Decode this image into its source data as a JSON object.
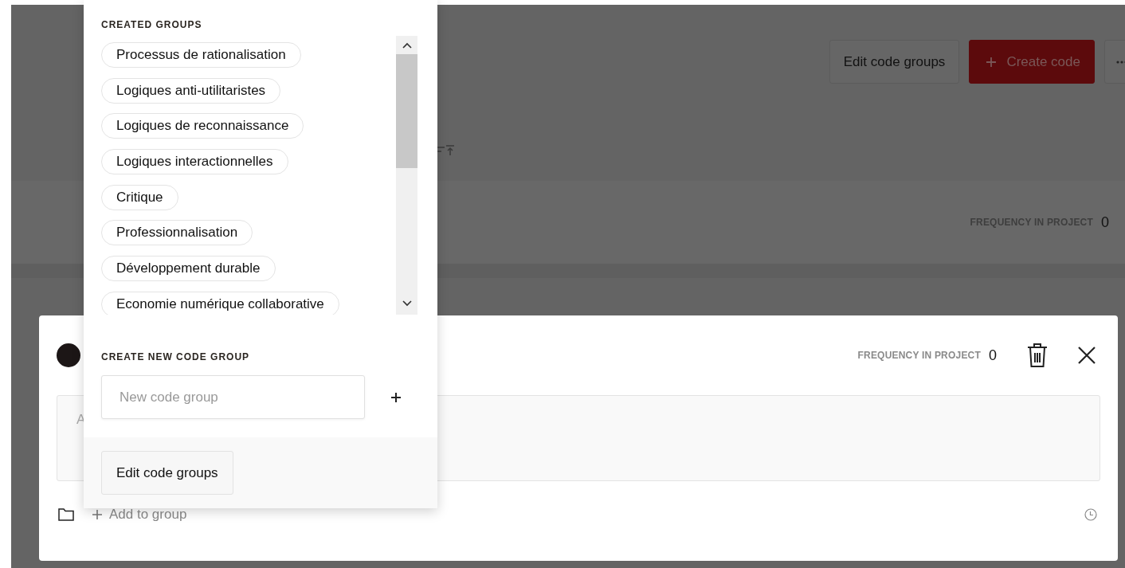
{
  "header": {
    "buttons": [
      {
        "label": "Edit code groups",
        "kind": "secondary"
      },
      {
        "label": "Create code",
        "kind": "primary"
      },
      {
        "kind": "more"
      }
    ]
  },
  "code_row": {
    "frequency_label": "FREQUENCY IN PROJECT",
    "frequency": "0"
  },
  "code_editor": {
    "frequency_label": "FREQUENCY IN PROJECT",
    "frequency": "0",
    "description_placeholder": "A",
    "add_to_group": "Add to group"
  },
  "group_picker": {
    "created_title": "CREATED GROUPS",
    "groups": [
      "Processus de rationalisation",
      "Logiques anti-utilitaristes",
      "Logiques de reconnaissance",
      "Logiques interactionnelles",
      "Critique",
      "Professionnalisation",
      "Développement durable",
      "Economie numérique collaborative"
    ],
    "create_title": "CREATE NEW CODE GROUP",
    "new_group_placeholder": "New code group",
    "edit_button": "Edit code groups"
  }
}
